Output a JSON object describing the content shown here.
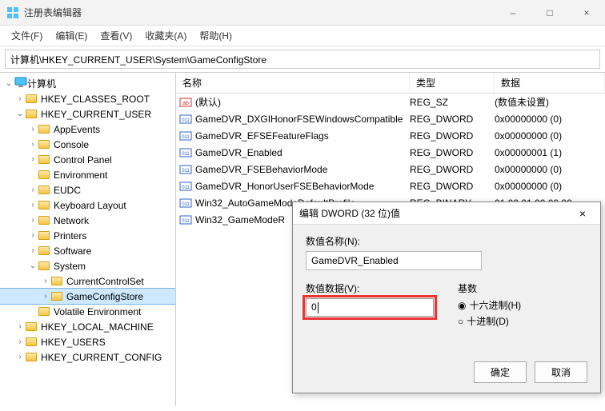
{
  "window": {
    "title": "注册表编辑器",
    "minimize": "–",
    "maximize": "□",
    "close": "×"
  },
  "menu": {
    "file": "文件(F)",
    "edit": "编辑(E)",
    "view": "查看(V)",
    "fav": "收藏夹(A)",
    "help": "帮助(H)"
  },
  "address": "计算机\\HKEY_CURRENT_USER\\System\\GameConfigStore",
  "tree": {
    "root": "计算机",
    "l1": [
      "HKEY_CLASSES_ROOT",
      "HKEY_CURRENT_USER",
      "HKEY_LOCAL_MACHINE",
      "HKEY_USERS",
      "HKEY_CURRENT_CONFIG"
    ],
    "hkcu": [
      "AppEvents",
      "Console",
      "Control Panel",
      "Environment",
      "EUDC",
      "Keyboard Layout",
      "Network",
      "Printers",
      "Software",
      "System",
      "Volatile Environment"
    ],
    "system": [
      "CurrentControlSet",
      "GameConfigStore"
    ]
  },
  "columns": {
    "name": "名称",
    "type": "类型",
    "data": "数据"
  },
  "values": [
    {
      "icon": "str",
      "name": "(默认)",
      "type": "REG_SZ",
      "data": "(数值未设置)"
    },
    {
      "icon": "bin",
      "name": "GameDVR_DXGIHonorFSEWindowsCompatible",
      "type": "REG_DWORD",
      "data": "0x00000000 (0)"
    },
    {
      "icon": "bin",
      "name": "GameDVR_EFSEFeatureFlags",
      "type": "REG_DWORD",
      "data": "0x00000000 (0)"
    },
    {
      "icon": "bin",
      "name": "GameDVR_Enabled",
      "type": "REG_DWORD",
      "data": "0x00000001 (1)"
    },
    {
      "icon": "bin",
      "name": "GameDVR_FSEBehaviorMode",
      "type": "REG_DWORD",
      "data": "0x00000000 (0)"
    },
    {
      "icon": "bin",
      "name": "GameDVR_HonorUserFSEBehaviorMode",
      "type": "REG_DWORD",
      "data": "0x00000000 (0)"
    },
    {
      "icon": "bin",
      "name": "Win32_AutoGameModeDefaultProfile",
      "type": "REG_BINARY",
      "data": "01 00 01 00 00 00"
    },
    {
      "icon": "bin",
      "name": "Win32_GameModeR",
      "type": "",
      "data": ""
    }
  ],
  "dialog": {
    "title": "编辑 DWORD (32 位)值",
    "close": "×",
    "name_label": "数值名称(N):",
    "name_value": "GameDVR_Enabled",
    "data_label": "数值数据(V):",
    "data_value": "0",
    "base_label": "基数",
    "hex": "十六进制(H)",
    "dec": "十进制(D)",
    "ok": "确定",
    "cancel": "取消"
  }
}
